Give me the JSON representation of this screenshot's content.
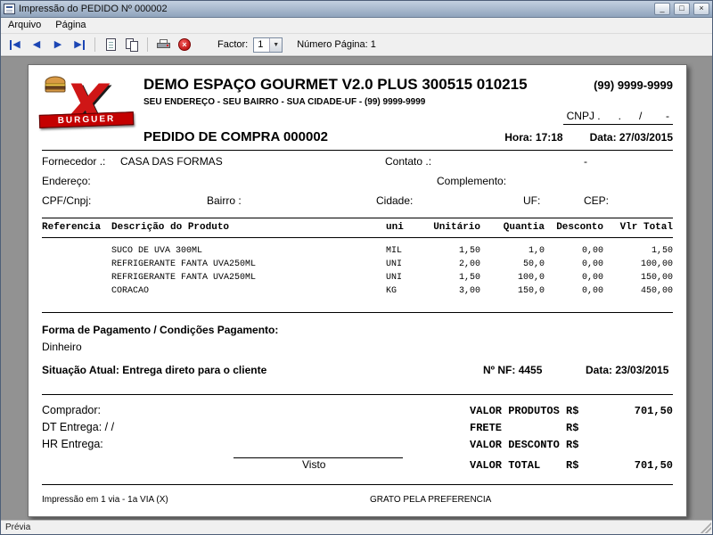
{
  "window": {
    "title": "Impressão do PEDIDO Nº 000002",
    "controls": {
      "minimize": "_",
      "maximize": "□",
      "close": "×"
    },
    "menu": [
      {
        "label": "Arquivo"
      },
      {
        "label": "Página"
      }
    ],
    "toolbar": {
      "nav_first": "◀",
      "nav_prev": "◀",
      "nav_next": "▶",
      "nav_last": "▶",
      "exit_glyph": "×",
      "factor_label": "Factor:",
      "factor_value": "1",
      "factor_arrow": "▼",
      "page_number_label": "Número Página: 1"
    },
    "status": "Prévia"
  },
  "logo": {
    "letter": "X",
    "banner": "BURGUER"
  },
  "header": {
    "company": "DEMO ESPAÇO GOURMET V2.0 PLUS 300515 010215",
    "phone": "(99) 9999-9999",
    "address_line": "SEU ENDEREÇO - SEU BAIRRO - SUA CIDADE-UF - (99) 9999-9999",
    "cnpj_line": "CNPJ .      .      /        -",
    "order_title": "PEDIDO DE COMPRA 000002",
    "time": "Hora: 17:18",
    "date": "Data: 27/03/2015"
  },
  "supplier": {
    "fornecedor_label": "Fornecedor .:",
    "fornecedor_value": "CASA DAS FORMAS",
    "contato_label": "Contato .:",
    "contato_value": "-",
    "endereco_label": "Endereço:",
    "complemento_label": "Complemento:",
    "cpf_label": "CPF/Cnpj:",
    "bairro_label": "Bairro :",
    "cidade_label": "Cidade:",
    "uf_label": "UF:",
    "cep_label": "CEP:"
  },
  "items": {
    "columns": [
      "Referencia",
      "Descrição do Produto",
      "uni",
      "Unitário",
      "Quantia",
      "Desconto",
      "Vlr Total"
    ],
    "rows": [
      {
        "referencia": "",
        "descricao": "SUCO DE UVA 300ML",
        "uni": "MIL",
        "unitario": "1,50",
        "quantia": "1,0",
        "desconto": "0,00",
        "vlr_total": "1,50"
      },
      {
        "referencia": "",
        "descricao": "REFRIGERANTE FANTA UVA250ML",
        "uni": "UNI",
        "unitario": "2,00",
        "quantia": "50,0",
        "desconto": "0,00",
        "vlr_total": "100,00"
      },
      {
        "referencia": "",
        "descricao": "REFRIGERANTE FANTA UVA250ML",
        "uni": "UNI",
        "unitario": "1,50",
        "quantia": "100,0",
        "desconto": "0,00",
        "vlr_total": "150,00"
      },
      {
        "referencia": "",
        "descricao": "CORACAO",
        "uni": "KG",
        "unitario": "3,00",
        "quantia": "150,0",
        "desconto": "0,00",
        "vlr_total": "450,00"
      }
    ]
  },
  "payment": {
    "label": "Forma de Pagamento / Condições Pagamento:",
    "value": "Dinheiro",
    "situacao": "Situação Atual: Entrega direto para o cliente",
    "nf": "Nº NF:  4455",
    "date": "Data: 23/03/2015"
  },
  "totals": {
    "comprador_label": "Comprador:",
    "dt_entrega_label": "DT Entrega:  / /",
    "hr_entrega_label": "HR Entrega:",
    "visto_label": "Visto",
    "valor_produtos_label": "VALOR PRODUTOS R$",
    "valor_produtos": "701,50",
    "frete_label": "FRETE          R$",
    "frete": "",
    "valor_desconto_label": "VALOR DESCONTO R$",
    "valor_desconto": "",
    "valor_total_label": "VALOR TOTAL    R$",
    "valor_total": "701,50"
  },
  "footer": {
    "left": "Impressão em 1 via -  1a VIA (X)",
    "center": "GRATO PELA PREFERENCIA"
  }
}
